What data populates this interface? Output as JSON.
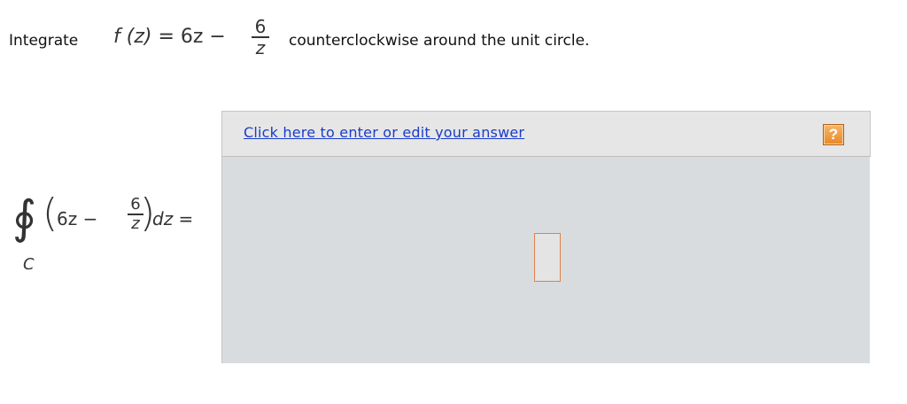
{
  "question": {
    "prefix": "Integrate",
    "function_lhs": "f (z)",
    "function_eq": " = 6z −",
    "fraction_num": "6",
    "fraction_den": "z",
    "suffix": "counterclockwise around the unit circle."
  },
  "integral": {
    "sign": "∮",
    "contour": "C",
    "open_paren": "(",
    "close_paren": ")",
    "expr_start": "6z −",
    "fraction_num": "6",
    "fraction_den": "z",
    "differential": "d",
    "variable": "z",
    "equals": " ="
  },
  "answer": {
    "link_text": "Click here to enter or edit your answer",
    "help_label": "?",
    "input_value": ""
  },
  "colors": {
    "link": "#1a3cc8",
    "help_button": "#e8872a",
    "input_border": "#e0814a",
    "panel_background": "#d9dcdf"
  },
  "icons": {
    "help": "question-mark-icon"
  }
}
